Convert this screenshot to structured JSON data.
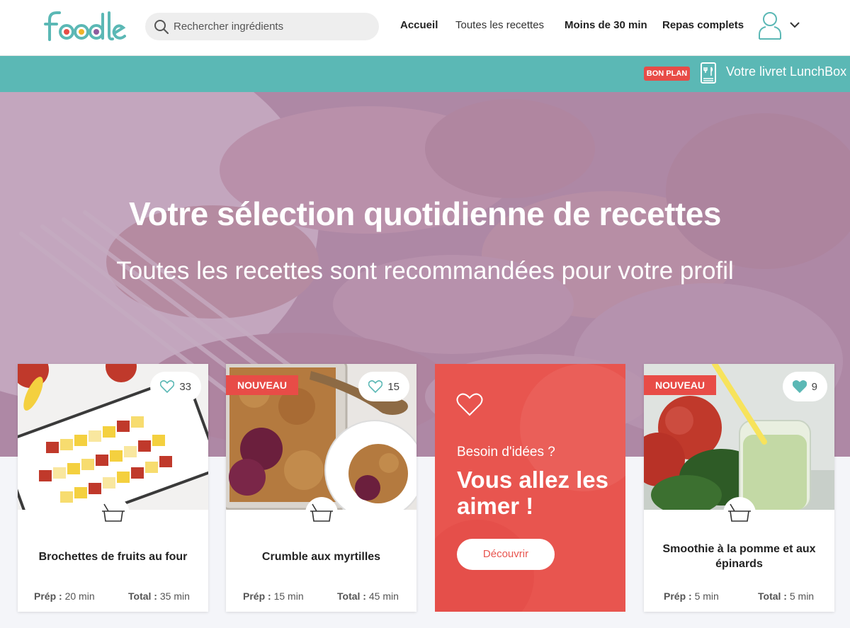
{
  "header": {
    "logo_text": "foodle",
    "search_placeholder": "Rechercher ingrédients",
    "nav": [
      "Accueil",
      "Toutes les recettes",
      "Moins de 30 min",
      "Repas complets"
    ]
  },
  "promo": {
    "badge": "BON PLAN",
    "text": "Votre livret LunchBox"
  },
  "hero": {
    "title": "Votre sélection quotidienne de recettes",
    "subtitle": "Toutes les recettes sont recommandées pour votre profil"
  },
  "cards": [
    {
      "title": "Brochettes de fruits au four",
      "likes": "33",
      "liked": false,
      "badge": "",
      "prep_label": "Prép :",
      "prep": "20 min",
      "total_label": "Total :",
      "total": "35 min"
    },
    {
      "title": "Crumble aux myrtilles",
      "likes": "15",
      "liked": false,
      "badge": "NOUVEAU",
      "prep_label": "Prép :",
      "prep": "15 min",
      "total_label": "Total :",
      "total": "45 min"
    },
    {
      "title": "Smoothie à la pomme et aux épinards",
      "likes": "9",
      "liked": true,
      "badge": "NOUVEAU",
      "prep_label": "Prép :",
      "prep": "5 min",
      "total_label": "Total :",
      "total": "5 min"
    }
  ],
  "cta": {
    "small": "Besoin d'idées ?",
    "big": "Vous allez les aimer !",
    "button": "Découvrir"
  },
  "colors": {
    "brand_teal": "#5bb8b5",
    "accent_red": "#e84c47",
    "hero_overlay": "#a07a98"
  },
  "icons": [
    "search-icon",
    "user-icon",
    "chevron-down-icon",
    "booklet-icon",
    "heart-icon",
    "pot-icon"
  ]
}
